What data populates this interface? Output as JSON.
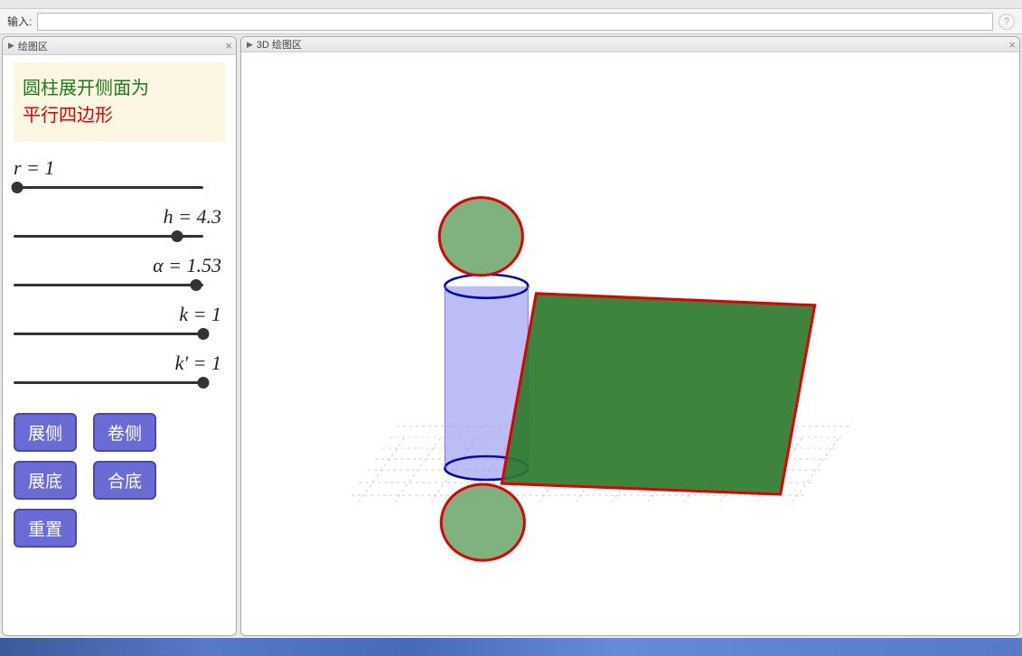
{
  "input_bar": {
    "label": "输入:",
    "value": "",
    "placeholder": ""
  },
  "panels": {
    "left": {
      "title": "绘图区"
    },
    "right": {
      "title": "3D 绘图区"
    }
  },
  "title_box": {
    "line1": "圆柱展开侧面为",
    "line2": "平行四边形"
  },
  "sliders": {
    "r": {
      "label": "r = 1",
      "value": 1,
      "min": 0,
      "max": 10,
      "pos": 0.02
    },
    "h": {
      "label": "h = 4.3",
      "value": 4.3,
      "min": 0,
      "max": 5,
      "pos": 0.86
    },
    "alpha": {
      "label": "α = 1.53",
      "value": 1.53,
      "min": 0,
      "max": 1.6,
      "pos": 0.96
    },
    "k": {
      "label": "k = 1",
      "value": 1,
      "min": 0,
      "max": 1,
      "pos": 1.0
    },
    "kp": {
      "label": "k′ = 1",
      "value": 1,
      "min": 0,
      "max": 1,
      "pos": 1.0
    }
  },
  "buttons": {
    "unfold_side": "展侧",
    "roll_side": "卷侧",
    "unfold_base": "展底",
    "fold_base": "合底",
    "reset": "重置"
  },
  "chart_data": {
    "type": "3d-figure",
    "description": "斜截圆柱及其侧面展开（平行四边形）与上下底面圆的三维示意图",
    "cylinder": {
      "radius": 1,
      "height": 4.3,
      "color": "#8a8aee",
      "edge_color": "#0000d0"
    },
    "unfolded_side": {
      "shape": "parallelogram",
      "width": 6.283,
      "height": 4.3,
      "fill": "#2d7a2d",
      "stroke": "#e00000"
    },
    "top_circle": {
      "radius": 1,
      "fill": "#6aa56a",
      "stroke": "#e00000"
    },
    "bottom_circle": {
      "radius": 1,
      "fill": "#6aa56a",
      "stroke": "#e00000"
    },
    "grid_plane": true
  }
}
